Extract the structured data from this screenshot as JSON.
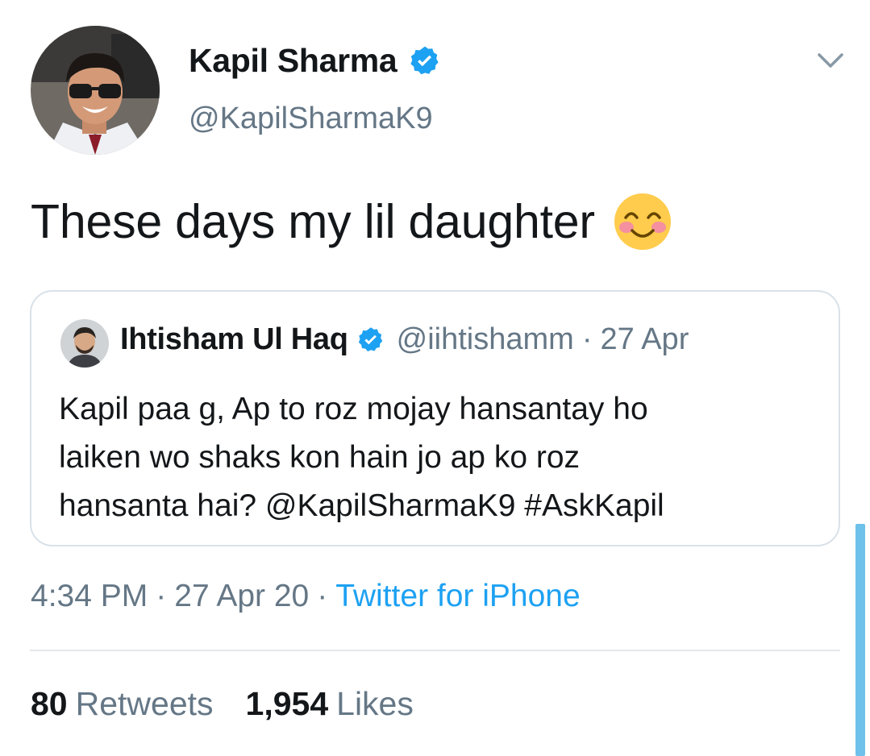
{
  "tweet": {
    "author": {
      "display_name": "Kapil Sharma",
      "handle": "@KapilSharmaK9",
      "verified": true,
      "avatar_icon": "user-avatar"
    },
    "menu_icon": "chevron-down-icon",
    "text": "These days my lil daughter",
    "emoji": "smiling-face-with-blushing-cheeks-emoji",
    "quoted_tweet": {
      "display_name": "Ihtisham Ul Haq",
      "handle": "@iihtishamm",
      "date": "27 Apr",
      "verified": true,
      "text_lines": [
        "Kapil paa g, Ap to roz mojay hansantay ho",
        "laiken wo shaks kon hain jo ap ko roz",
        "hansanta hai? @KapilSharmaK9 #AskKapil"
      ]
    },
    "meta": {
      "time": "4:34 PM",
      "date": "27 Apr 20",
      "separator": "·",
      "source": "Twitter for iPhone"
    },
    "stats": {
      "retweets_count": "80",
      "retweets_label": "Retweets",
      "likes_count": "1,954",
      "likes_label": "Likes"
    }
  },
  "colors": {
    "text_primary": "#14171a",
    "text_secondary": "#657786",
    "link_blue": "#1da1f2",
    "border": "#d9e1e8",
    "scrollbar": "#6ec1ea"
  }
}
